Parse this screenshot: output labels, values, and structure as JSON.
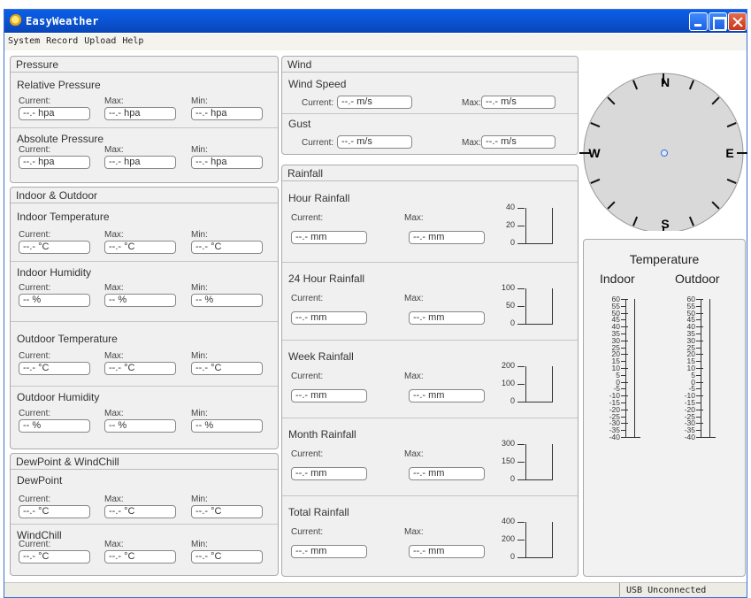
{
  "window": {
    "title": "EasyWeather"
  },
  "menu": [
    "System",
    "Record",
    "Upload",
    "Help"
  ],
  "labels": {
    "current": "Current:",
    "max": "Max:",
    "min": "Min:"
  },
  "pressure": {
    "title": "Pressure",
    "relative": {
      "title": "Relative Pressure",
      "current": "--.- hpa",
      "max": "--.- hpa",
      "min": "--.- hpa"
    },
    "absolute": {
      "title": "Absolute Pressure",
      "current": "--.- hpa",
      "max": "--.- hpa",
      "min": "--.- hpa"
    }
  },
  "indoor_outdoor": {
    "title": "Indoor & Outdoor",
    "indoor_temp": {
      "title": "Indoor Temperature",
      "current": "--.- °C",
      "max": "--.- °C",
      "min": "--.- °C"
    },
    "indoor_humidity": {
      "title": "Indoor Humidity",
      "current": "-- %",
      "max": "-- %",
      "min": "-- %"
    },
    "outdoor_temp": {
      "title": "Outdoor Temperature",
      "current": "--.- °C",
      "max": "--.- °C",
      "min": "--.- °C"
    },
    "outdoor_humidity": {
      "title": "Outdoor Humidity",
      "current": "-- %",
      "max": "-- %",
      "min": "-- %"
    }
  },
  "dew_wind": {
    "title": "DewPoint & WindChill",
    "dewpoint": {
      "title": "DewPoint",
      "current": "--.- °C",
      "max": "--.- °C",
      "min": "--.- °C"
    },
    "windchill": {
      "title": "WindChill",
      "current": "--.- °C",
      "max": "--.- °C",
      "min": "--.- °C"
    }
  },
  "wind": {
    "title": "Wind",
    "speed": {
      "title": "Wind Speed",
      "current": "--.- m/s",
      "max": "--.- m/s"
    },
    "gust": {
      "title": "Gust",
      "current": "--.- m/s",
      "max": "--.- m/s"
    }
  },
  "rainfall": {
    "title": "Rainfall",
    "sections": [
      {
        "title": "Hour Rainfall",
        "current": "--.- mm",
        "max": "--.- mm",
        "ticks": [
          "40",
          "20",
          "0"
        ]
      },
      {
        "title": "24 Hour Rainfall",
        "current": "--.- mm",
        "max": "--.- mm",
        "ticks": [
          "100",
          "50",
          "0"
        ]
      },
      {
        "title": "Week Rainfall",
        "current": "--.- mm",
        "max": "--.- mm",
        "ticks": [
          "200",
          "100",
          "0"
        ]
      },
      {
        "title": "Month Rainfall",
        "current": "--.- mm",
        "max": "--.- mm",
        "ticks": [
          "300",
          "150",
          "0"
        ]
      },
      {
        "title": "Total Rainfall",
        "current": "--.- mm",
        "max": "--.- mm",
        "ticks": [
          "400",
          "200",
          "0"
        ]
      }
    ]
  },
  "compass": {
    "north": "N",
    "south": "S",
    "east": "E",
    "west": "W"
  },
  "temperature_panel": {
    "title": "Temperature",
    "indoor": "Indoor",
    "outdoor": "Outdoor",
    "ticks": [
      "60",
      "55",
      "50",
      "45",
      "40",
      "35",
      "30",
      "25",
      "20",
      "15",
      "10",
      "5",
      "0",
      "-5",
      "-10",
      "-15",
      "-20",
      "-25",
      "-30",
      "-35",
      "-40"
    ]
  },
  "status": {
    "usb": "USB Unconnected"
  },
  "colors": {
    "titlebar": "#0b55d4",
    "panel": "#f0f0f0",
    "compass_face": "#d9d9d9",
    "close_button": "#c8381a"
  }
}
